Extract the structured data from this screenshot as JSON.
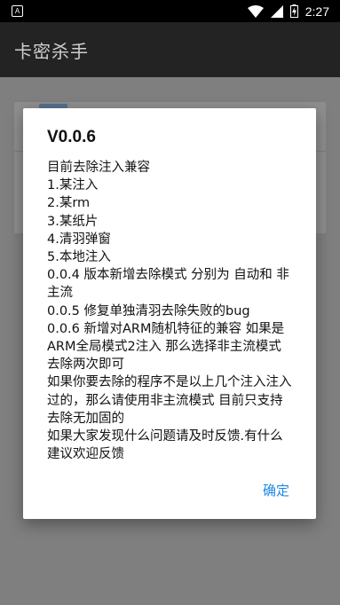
{
  "status_bar": {
    "time": "2:27"
  },
  "app_bar": {
    "title": "卡密杀手"
  },
  "dialog": {
    "title": "V0.0.6",
    "body": "目前去除注入兼容\n1.某注入\n2.某rm\n3.某纸片\n4.清羽弹窗\n5.本地注入\n0.0.4 版本新增去除模式 分别为 自动和 非主流\n0.0.5 修复单独清羽去除失败的bug\n0.0.6 新增对ARM随机特征的兼容 如果是ARM全局模式2注入 那么选择非主流模式去除两次即可\n如果你要去除的程序不是以上几个注入注入过的，那么请使用非主流模式 目前只支持去除无加固的\n如果大家发现什么问题请及时反馈.有什么建议欢迎反馈",
    "ok_label": "确定"
  },
  "colors": {
    "accent": "#1e88e5",
    "app_bar_bg": "#232323",
    "status_bar_bg": "#000000",
    "scrim": "#7f7f7f"
  },
  "icons": [
    "notification-icon",
    "wifi-icon",
    "signal-icon",
    "battery-charging-icon"
  ]
}
